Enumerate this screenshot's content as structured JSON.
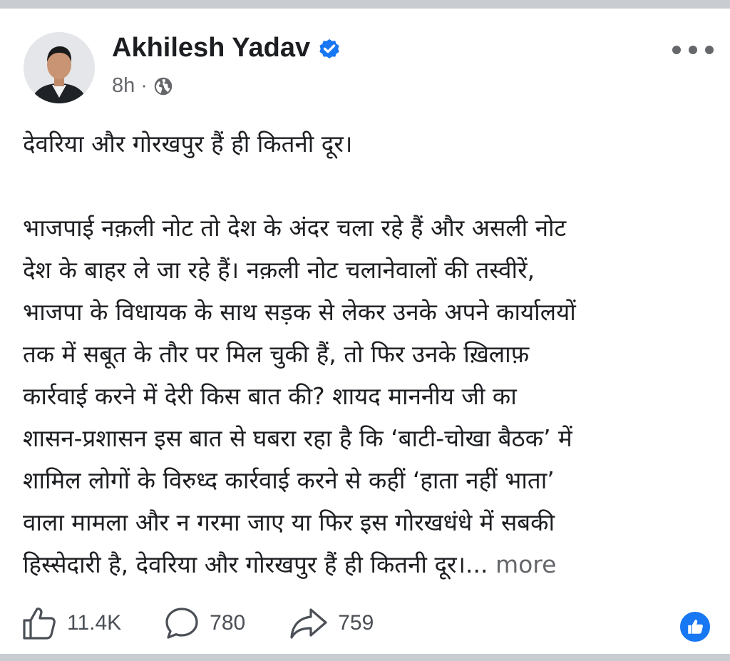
{
  "post": {
    "author": "Akhilesh Yadav",
    "verified_icon": "verified-badge-icon",
    "time": "8h",
    "separator": "·",
    "audience_icon": "globe-icon",
    "menu_icon": "more-options-icon",
    "text": {
      "line_1": "देवरिया और गोरखपुर हैं ही कितनी दूर।",
      "para_lines": [
        "भाजपाई नक़ली नोट तो देश के अंदर चला रहे हैं और असली नोट",
        "देश के बाहर ले जा रहे हैं। नक़ली नोट चलानेवालों की तस्वीरें,",
        "भाजपा के विधायक के साथ सड़क से लेकर उनके अपने कार्यालयों",
        "तक में सबूत के तौर पर मिल चुकी हैं, तो फिर उनके ख़िलाफ़",
        "कार्रवाई करने में देरी किस बात की? शायद माननीय जी का",
        "शासन-प्रशासन इस बात से घबरा रहा है कि ‘बाटी-चोखा बैठक’ में",
        "शामिल लोगों के विरुध्द कार्रवाई करने से कहीं ‘हाता नहीं भाता’",
        "वाला मामला और न गरमा जाए या फिर इस गोरखधंधे में सबकी"
      ],
      "last_line": "हिस्सेदारी है, देवरिया और गोरखपुर हैं ही कितनी दूर।...",
      "see_more": " more"
    }
  },
  "actions": {
    "likes": "11.4K",
    "comments": "780",
    "shares": "759",
    "like_icon": "thumbs-up-icon",
    "comment_icon": "comment-bubble-icon",
    "share_icon": "share-arrow-icon",
    "reaction_icon": "like-reaction-icon"
  },
  "colors": {
    "brand_blue": "#1877f2",
    "secondary_text": "#65676b",
    "divider": "#c9ccd1"
  }
}
